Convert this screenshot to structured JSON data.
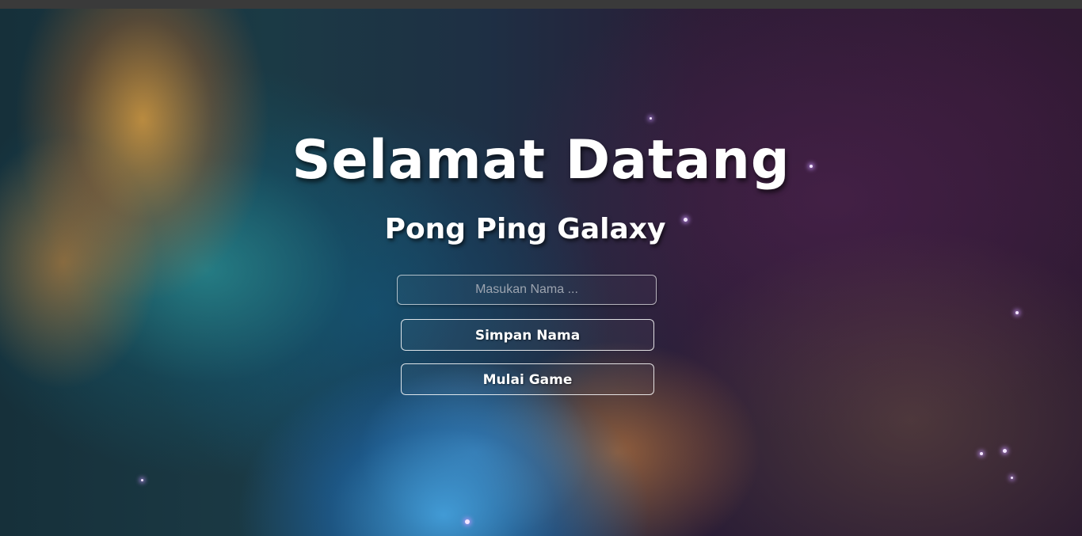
{
  "welcome": {
    "title": "Selamat Datang",
    "subtitle": "Pong Ping Galaxy"
  },
  "form": {
    "name_placeholder": "Masukan Nama ...",
    "name_value": "",
    "save_label": "Simpan Nama",
    "start_label": "Mulai Game"
  },
  "theme": {
    "text_color": "#ffffff",
    "star_color": "#f3e6ff"
  }
}
